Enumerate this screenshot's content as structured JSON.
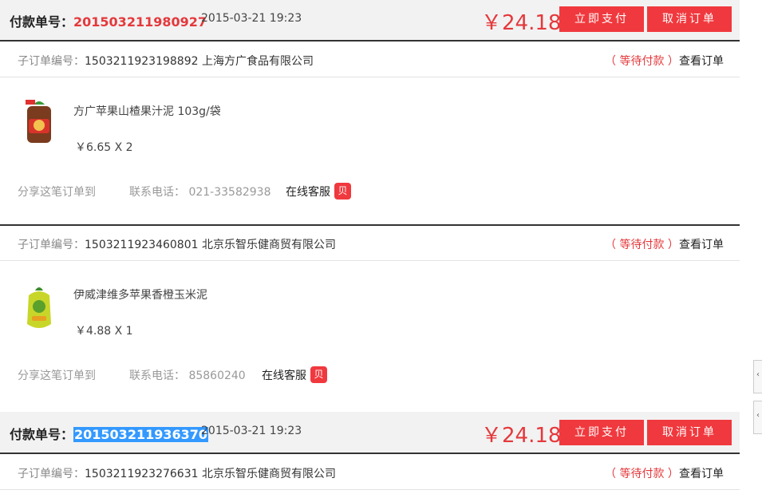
{
  "orders": [
    {
      "pay_label": "付款单号：",
      "pay_no": "201503211980927",
      "time": "2015-03-21 19:23",
      "amount": "￥24.18",
      "pay_btn": "立即支付",
      "cancel_btn": "取消订单"
    },
    {
      "pay_label": "付款单号：",
      "pay_no": "201503211936370",
      "time": "2015-03-21 19:23",
      "amount": "￥24.18",
      "pay_btn": "立即支付",
      "cancel_btn": "取消订单"
    }
  ],
  "suborders": [
    {
      "label": "子订单编号：",
      "no_shop": "1503211923198892 上海方广食品有限公司",
      "status": "（ 等待付款 ）",
      "view": "查看订单",
      "product_name": "方广苹果山楂果汁泥 103g/袋",
      "product_price": "￥6.65 X 2",
      "share": "分享这笔订单到",
      "phone": "联系电话： 021-33582938",
      "kefu": "在线客服",
      "badge": "贝"
    },
    {
      "label": "子订单编号：",
      "no_shop": "1503211923460801 北京乐智乐健商贸有限公司",
      "status": "（ 等待付款 ）",
      "view": "查看订单",
      "product_name": "伊威津维多苹果香橙玉米泥",
      "product_price": "￥4.88 X 1",
      "share": "分享这笔订单到",
      "phone": "联系电话： 85860240",
      "kefu": "在线客服",
      "badge": "贝"
    },
    {
      "label": "子订单编号：",
      "no_shop": "1503211923276631 北京乐智乐健商贸有限公司",
      "status": "（ 等待付款 ）",
      "view": "查看订单"
    }
  ],
  "colors": {
    "accent": "#e4393c",
    "button": "#f0393e",
    "selection": "#3399ff"
  },
  "icons": {
    "scroll_tab": "chevron-left-icon"
  }
}
